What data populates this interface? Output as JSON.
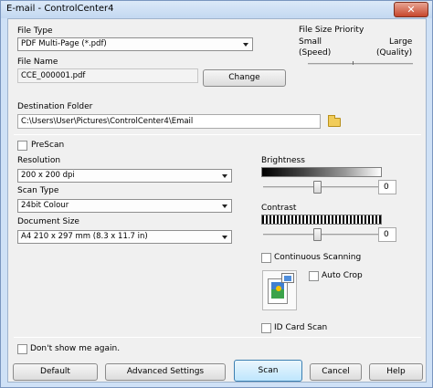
{
  "window": {
    "title": "E-mail - ControlCenter4",
    "close_glyph": "✕"
  },
  "file_type": {
    "label": "File Type",
    "value": "PDF Multi-Page (*.pdf)"
  },
  "file_size": {
    "label": "File Size Priority",
    "small": "Small",
    "small_sub": "(Speed)",
    "large": "Large",
    "large_sub": "(Quality)"
  },
  "file_name": {
    "label": "File Name",
    "value": "CCE_000001.pdf",
    "change_label": "Change"
  },
  "destination": {
    "label": "Destination Folder",
    "value": "C:\\Users\\User\\Pictures\\ControlCenter4\\Email"
  },
  "prescan": {
    "label": "PreScan"
  },
  "resolution": {
    "label": "Resolution",
    "value": "200 x 200 dpi"
  },
  "scan_type": {
    "label": "Scan Type",
    "value": "24bit Colour"
  },
  "document_size": {
    "label": "Document Size",
    "value": "A4 210 x 297 mm (8.3 x 11.7 in)"
  },
  "brightness": {
    "label": "Brightness",
    "value": "0"
  },
  "contrast": {
    "label": "Contrast",
    "value": "0"
  },
  "continuous": {
    "label": "Continuous Scanning"
  },
  "auto_crop": {
    "label": "Auto Crop"
  },
  "id_card": {
    "label": "ID Card Scan"
  },
  "dont_show": {
    "label": "Don't show me again."
  },
  "buttons": {
    "default": "Default",
    "advanced": "Advanced Settings",
    "scan": "Scan",
    "cancel": "Cancel",
    "help": "Help"
  }
}
